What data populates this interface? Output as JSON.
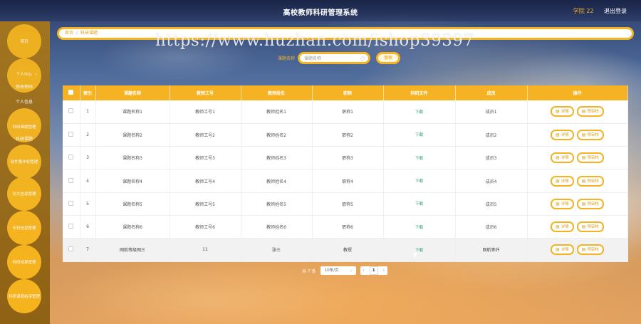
{
  "header": {
    "title": "高校教师科研管理系统",
    "user": "学院 22",
    "logout": "退出登录"
  },
  "sidebar": {
    "items": [
      {
        "label": "首页"
      },
      {
        "label": "个人中心",
        "subs": [
          "修改密码",
          "个人信息"
        ]
      },
      {
        "label": "科研课题管理",
        "subs": [
          "科研课题"
        ]
      },
      {
        "label": "软件著作权管理"
      },
      {
        "label": "论文信息管理"
      },
      {
        "label": "专利信息管理"
      },
      {
        "label": "科研成果管理"
      },
      {
        "label": "科研课题结审管理"
      }
    ]
  },
  "breadcrumb": {
    "home": "首页",
    "current": "科研课题"
  },
  "search": {
    "label": "课题名称",
    "placeholder": "课题名称",
    "button": "搜索"
  },
  "table": {
    "headers": [
      "",
      "索引",
      "课题名称",
      "教师工号",
      "教师姓名",
      "职称",
      "科研文件",
      "成员",
      "操作"
    ],
    "rows": [
      {
        "index": "1",
        "name": "课题名称1",
        "teacher_id": "教师工号1",
        "teacher_name": "教师姓名1",
        "title": "职称1",
        "file": "下载",
        "member": "成员1"
      },
      {
        "index": "2",
        "name": "课题名称2",
        "teacher_id": "教师工号2",
        "teacher_name": "教师姓名2",
        "title": "职称2",
        "file": "下载",
        "member": "成员2"
      },
      {
        "index": "3",
        "name": "课题名称3",
        "teacher_id": "教师工号3",
        "teacher_name": "教师姓名3",
        "title": "职称3",
        "file": "下载",
        "member": "成员3"
      },
      {
        "index": "4",
        "name": "课题名称4",
        "teacher_id": "教师工号4",
        "teacher_name": "教师姓名4",
        "title": "职称4",
        "file": "下载",
        "member": "成员4"
      },
      {
        "index": "5",
        "name": "课题名称5",
        "teacher_id": "教师工号5",
        "teacher_name": "教师姓名5",
        "title": "职称5",
        "file": "下载",
        "member": "成员5"
      },
      {
        "index": "6",
        "name": "课题名称6",
        "teacher_id": "教师工号6",
        "teacher_name": "教师姓名6",
        "title": "职称6",
        "file": "下载",
        "member": "成员6"
      },
      {
        "index": "7",
        "name": "网航等级网三",
        "teacher_id": "11",
        "teacher_name": "张三",
        "title": "教授",
        "file": "下载",
        "member": "网航等纤"
      }
    ],
    "actions": {
      "detail": "详情",
      "review": "预审核"
    }
  },
  "pagination": {
    "total": "共 7 条",
    "page_size": "10条/页",
    "current_page": "1",
    "prev": "‹",
    "next": "›"
  },
  "watermark": "https://www.huzhan.com/ishop39397",
  "colors": {
    "accent": "#f5b323",
    "sidebar": "#a8771a",
    "download": "#25a06a"
  }
}
